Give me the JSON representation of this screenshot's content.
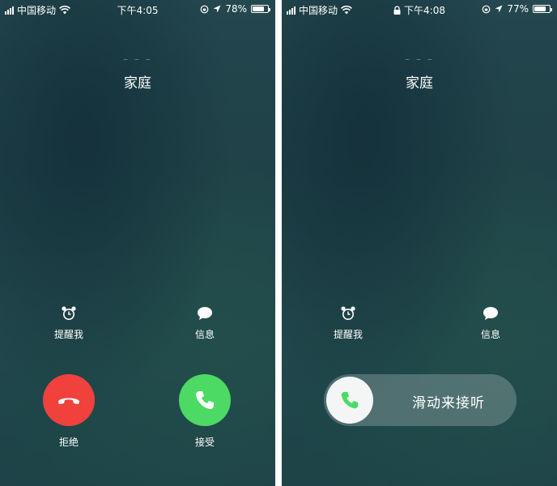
{
  "left_screen": {
    "status": {
      "carrier": "中国移动",
      "time": "下午4:05",
      "battery_percent": "78%",
      "battery_level": 0.78
    },
    "caller": {
      "number_hint": "– – –",
      "name": "家庭"
    },
    "actions": {
      "remind_label": "提醒我",
      "message_label": "信息",
      "decline_label": "拒绝",
      "accept_label": "接受"
    },
    "colors": {
      "decline": "#f0413c",
      "accept": "#4cd964"
    },
    "icons": [
      "alarm-clock-icon",
      "message-bubble-icon",
      "phone-hangup-icon",
      "phone-icon",
      "wifi-icon",
      "signal-icon",
      "battery-icon",
      "orientation-lock-icon",
      "location-arrow-icon"
    ]
  },
  "right_screen": {
    "status": {
      "carrier": "中国移动",
      "time": "下午4:08",
      "battery_percent": "77%",
      "battery_level": 0.77
    },
    "caller": {
      "number_hint": "– – –",
      "name": "家庭"
    },
    "actions": {
      "remind_label": "提醒我",
      "message_label": "信息",
      "slide_label": "滑动来接听"
    },
    "icons": [
      "lock-icon",
      "alarm-clock-icon",
      "message-bubble-icon",
      "phone-icon"
    ]
  }
}
